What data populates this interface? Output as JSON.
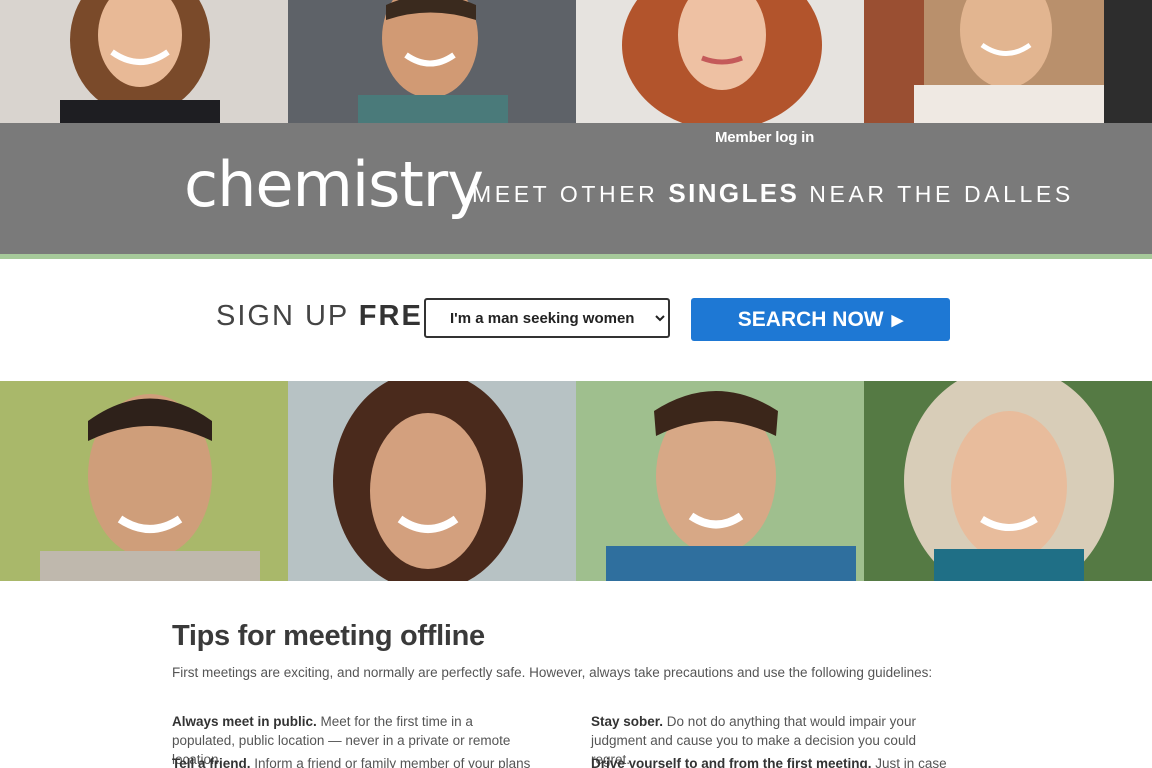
{
  "header": {
    "member_login": "Member log in",
    "logo": "chemistry",
    "tagline_pre": "MEET OTHER ",
    "tagline_em": "SINGLES",
    "tagline_post": " NEAR THE DALLES",
    "bg_color": "#7a7a7a",
    "rule_color": "#a6c99a"
  },
  "signup": {
    "label_pre": "SIGN UP ",
    "label_em": "FREE",
    "label_post": ":",
    "select_value": "I'm a man seeking women",
    "search_label": "SEARCH NOW",
    "search_icon": "play-arrow-icon",
    "button_color": "#1e78d4"
  },
  "photos": {
    "top": [
      "photo-woman-brown-hair",
      "photo-man-smiling",
      "photo-woman-red-curly-hair",
      "photo-man-hand-on-chin"
    ],
    "middle": [
      "photo-man-dark-hair",
      "photo-woman-brunette",
      "photo-man-blue-shirt",
      "photo-woman-blonde"
    ]
  },
  "tips": {
    "title": "Tips for meeting offline",
    "intro": "First meetings are exciting, and normally are perfectly safe. However, always take precautions and use the following guidelines:",
    "items": [
      {
        "title": "Always meet in public.",
        "text": " Meet for the first time in a populated, public location — never in a private or remote location."
      },
      {
        "title": "Stay sober.",
        "text": " Do not do anything that would impair your judgment and cause you to make a decision you could regret."
      },
      {
        "title": "Tell a friend.",
        "text": " Inform a friend or family member of your plans and"
      },
      {
        "title": "Drive yourself to and from the first meeting.",
        "text": " Just in case things"
      }
    ]
  }
}
